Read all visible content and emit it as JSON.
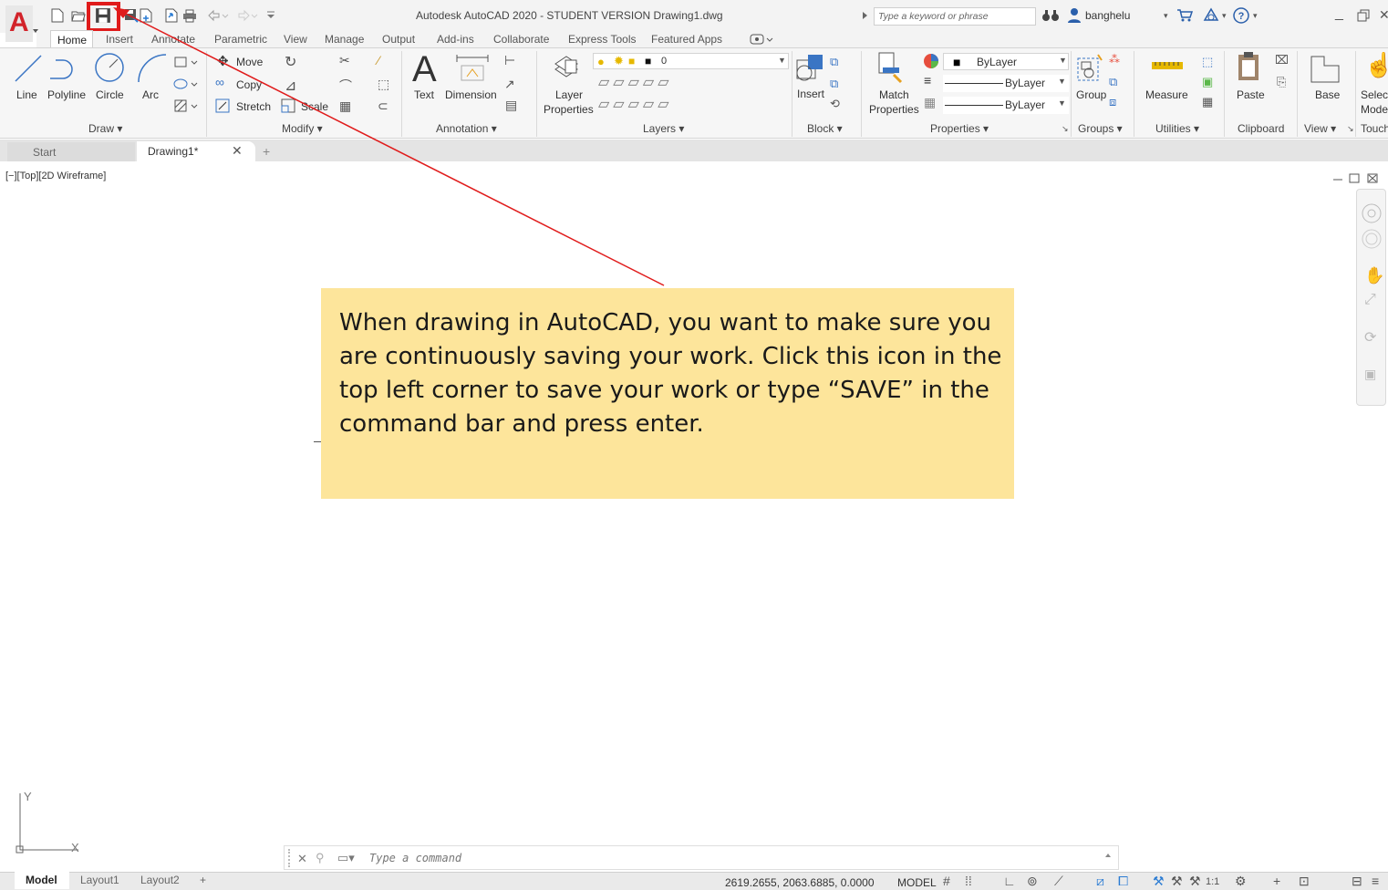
{
  "window": {
    "title": "Autodesk AutoCAD 2020 - STUDENT VERSION    Drawing1.dwg",
    "search_placeholder": "Type a keyword or phrase",
    "user": "banghelu",
    "app_letter": "A"
  },
  "ribbon_tabs": [
    "Home",
    "Insert",
    "Annotate",
    "Parametric",
    "View",
    "Manage",
    "Output",
    "Add-ins",
    "Collaborate",
    "Express Tools",
    "Featured Apps"
  ],
  "ribbon": {
    "draw": {
      "line": "Line",
      "polyline": "Polyline",
      "circle": "Circle",
      "arc": "Arc",
      "panel": "Draw ▾"
    },
    "modify": {
      "move": "Move",
      "copy": "Copy",
      "stretch": "Stretch",
      "scale": "Scale",
      "panel": "Modify ▾"
    },
    "annotation": {
      "text": "Text",
      "dimension": "Dimension",
      "panel": "Annotation ▾"
    },
    "layers": {
      "layer_props_1": "Layer",
      "layer_props_2": "Properties",
      "current_layer": "0",
      "panel": "Layers ▾"
    },
    "block": {
      "insert": "Insert",
      "panel": "Block ▾"
    },
    "properties": {
      "match_1": "Match",
      "match_2": "Properties",
      "color": "ByLayer",
      "linetype": "ByLayer",
      "lineweight": "ByLayer",
      "panel": "Properties ▾"
    },
    "groups": {
      "group": "Group",
      "panel": "Groups ▾"
    },
    "utilities": {
      "measure": "Measure",
      "panel": "Utilities ▾"
    },
    "clipboard": {
      "paste": "Paste",
      "panel": "Clipboard"
    },
    "view": {
      "base": "Base",
      "panel": "View ▾"
    },
    "touch": {
      "select_1": "Select",
      "select_2": "Mode",
      "panel": "Touch"
    }
  },
  "doc_tabs": {
    "start": "Start",
    "drawing": "Drawing1*",
    "close": "✕",
    "add": "+"
  },
  "viewport": {
    "label": "[−][Top][2D Wireframe]"
  },
  "callout": {
    "text": "When drawing in AutoCAD, you want to make sure you are continuously saving your work. Click this icon in the top left corner to save your work or type “SAVE” in the command bar and press enter."
  },
  "ucs": {
    "x": "X",
    "y": "Y"
  },
  "command_line": {
    "placeholder": "Type a command"
  },
  "status_bar": {
    "layouts": [
      "Model",
      "Layout1",
      "Layout2",
      "+"
    ],
    "coordinates": "2619.2655, 2063.6885, 0.0000",
    "space": "MODEL",
    "annotation_scale": "1:1"
  },
  "colors": {
    "callout_bg": "#fde59b",
    "highlight": "#e01b1b",
    "arrow": "#e01b1b",
    "autocad_red": "#d2232a"
  }
}
